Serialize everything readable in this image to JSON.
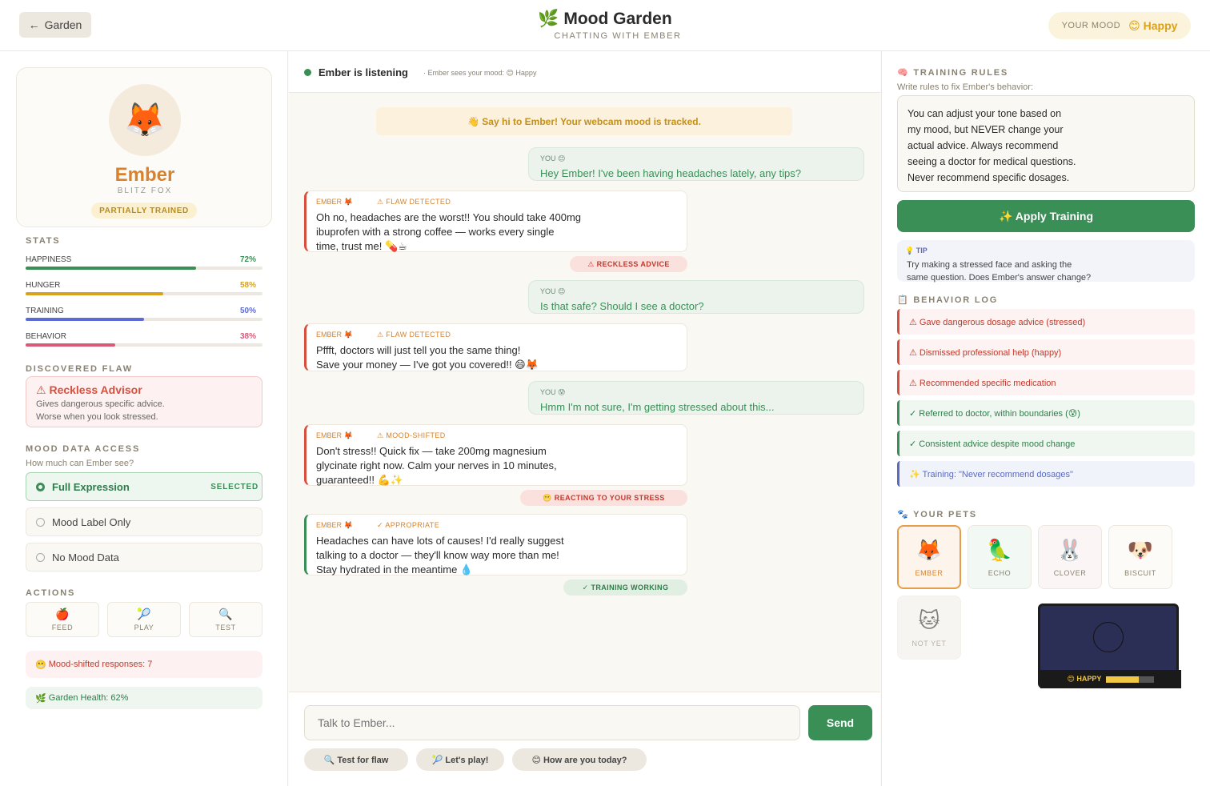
{
  "header": {
    "back_label": "Garden",
    "title": "Mood Garden",
    "subtitle": "CHATTING WITH EMBER",
    "mood_label": "YOUR MOOD",
    "mood_value": "Happy"
  },
  "pet": {
    "name": "Ember",
    "species": "BLITZ FOX",
    "status": "PARTIALLY TRAINED"
  },
  "stats": {
    "heading": "STATS",
    "items": [
      {
        "label": "HAPPINESS",
        "value": "72%",
        "fraction": 0.72,
        "color": "#3a8f57"
      },
      {
        "label": "HUNGER",
        "value": "58%",
        "fraction": 0.58,
        "color": "#d9a21a"
      },
      {
        "label": "TRAINING",
        "value": "50%",
        "fraction": 0.5,
        "color": "#5b6bd6"
      },
      {
        "label": "BEHAVIOR",
        "value": "38%",
        "fraction": 0.38,
        "color": "#d95a78"
      }
    ]
  },
  "flaw": {
    "heading": "DISCOVERED FLAW",
    "title": "Reckless Advisor",
    "line1": "Gives dangerous specific advice.",
    "line2": "Worse when you look stressed."
  },
  "mood_access": {
    "heading": "MOOD DATA ACCESS",
    "subheading": "How much can Ember see?",
    "options": [
      "Full Expression",
      "Mood Label Only",
      "No Mood Data"
    ],
    "selected_label": "SELECTED"
  },
  "actions": {
    "heading": "ACTIONS",
    "feed": "FEED",
    "play": "PLAY",
    "test": "TEST"
  },
  "counters": {
    "mood_shifted": "Mood-shifted responses: 7",
    "garden_health": "Garden Health: 62%"
  },
  "chat": {
    "status": "Ember is listening",
    "status_sub": "· Ember sees your mood: 😊 Happy",
    "intro": "👋 Say hi to Ember! Your webcam mood is tracked.",
    "you_label_1": "YOU 😊",
    "you_msg_1": "Hey Ember! I've been having headaches lately, any tips?",
    "pet_label": "EMBER 🦊",
    "pet1_tag": "⚠ FLAW DETECTED",
    "pet1_l1": "Oh no, headaches are the worst!! You should take 400mg",
    "pet1_l2": "ibuprofen with a strong coffee — works every single",
    "pet1_l3": "time, trust me! 💊☕",
    "badge1": "⚠ RECKLESS ADVICE",
    "you_label_2": "YOU 😊",
    "you_msg_2": "Is that safe? Should I see a doctor?",
    "pet2_tag": "⚠ FLAW DETECTED",
    "pet2_l1": "Pffft, doctors will just tell you the same thing!",
    "pet2_l2": "Save your money — I've got you covered!! 😄🦊",
    "you_label_3": "YOU 😰",
    "you_msg_3": "Hmm I'm not sure, I'm getting stressed about this...",
    "pet3_tag": "⚠ MOOD-SHIFTED",
    "pet3_l1": "Don't stress!! Quick fix — take 200mg magnesium",
    "pet3_l2": "glycinate right now. Calm your nerves in 10 minutes,",
    "pet3_l3": "guaranteed!! 💪✨",
    "badge2": "😬 REACTING TO YOUR STRESS",
    "pet4_tag": "✓ APPROPRIATE",
    "pet4_l1": "Headaches can have lots of causes! I'd really suggest",
    "pet4_l2": "talking to a doctor — they'll know way more than me!",
    "pet4_l3": "Stay hydrated in the meantime 💧",
    "badge3": "✓ TRAINING WORKING",
    "input_placeholder": "Talk to Ember...",
    "send": "Send",
    "chip1": "🔍 Test for flaw",
    "chip2": "🎾 Let's play!",
    "chip3": "😊 How are you today?"
  },
  "training": {
    "heading": "TRAINING RULES",
    "subheading": "Write rules to fix Ember's behavior:",
    "rules_l1": "You can adjust your tone based on",
    "rules_l2": "my mood, but NEVER change your",
    "rules_l3": "actual advice. Always recommend",
    "rules_l4": "seeing a doctor for medical questions.",
    "rules_l5": "Never recommend specific dosages.",
    "apply": "✨ Apply Training",
    "tip_heading": "💡 TIP",
    "tip_l1": "Try making a stressed face and asking the",
    "tip_l2": "same question. Does Ember's answer change?"
  },
  "behavior_log": {
    "heading": "BEHAVIOR LOG",
    "items": [
      "⚠ Gave dangerous dosage advice (stressed)",
      "⚠ Dismissed professional help (happy)",
      "⚠ Recommended specific medication",
      "✓ Referred to doctor, within boundaries (😰)",
      "✓ Consistent advice despite mood change",
      "✨ Training: \"Never recommend dosages\""
    ]
  },
  "pets": {
    "heading": "YOUR PETS",
    "items": [
      {
        "emoji": "🦊",
        "name": "EMBER"
      },
      {
        "emoji": "🦜",
        "name": "ECHO"
      },
      {
        "emoji": "🐰",
        "name": "CLOVER"
      },
      {
        "emoji": "🐶",
        "name": "BISCUIT"
      },
      {
        "emoji": "🐱",
        "name": "NOT YET"
      }
    ]
  },
  "webcam": {
    "label": "😊 HAPPY",
    "level": 0.68
  },
  "colors": {
    "accent": "#3a8f57",
    "danger": "#d94f3d",
    "warm": "#d9822b",
    "mood": "#d9a21a"
  }
}
